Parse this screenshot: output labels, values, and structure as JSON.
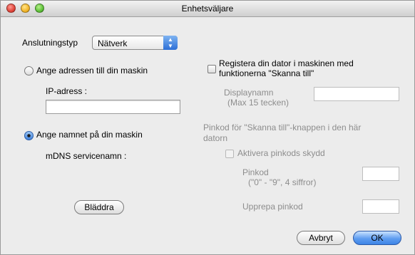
{
  "window": {
    "title": "Enhetsväljare"
  },
  "connection": {
    "label": "Anslutningstyp",
    "selected": "Nätverk"
  },
  "left": {
    "radio_address_label": "Ange adressen till din maskin",
    "ip_label": "IP-adress :",
    "ip_value": "",
    "radio_name_label": "Ange namnet på din maskin",
    "mdns_label": "mDNS servicenamn :",
    "browse_button": "Bläddra"
  },
  "right": {
    "register_label_line1": "Registera din dator i maskinen med",
    "register_label_line2": "funktionerna \"Skanna till\"",
    "display_name_label": "Displaynamn",
    "display_name_hint": "(Max 15 tecken)",
    "display_name_value": "",
    "pin_section_line1": "Pinkod för \"Skanna  till\"-knappen i den här",
    "pin_section_line2": "datorn",
    "pin_protect_label": "Aktivera pinkods skydd",
    "pin_label": "Pinkod",
    "pin_hint": "(\"0\" - \"9\", 4 siffror)",
    "pin_value": "",
    "repeat_pin_label": "Upprepa pinkod",
    "repeat_pin_value": ""
  },
  "footer": {
    "cancel_button": "Avbryt",
    "ok_button": "OK"
  },
  "selection": {
    "mode": "name"
  }
}
